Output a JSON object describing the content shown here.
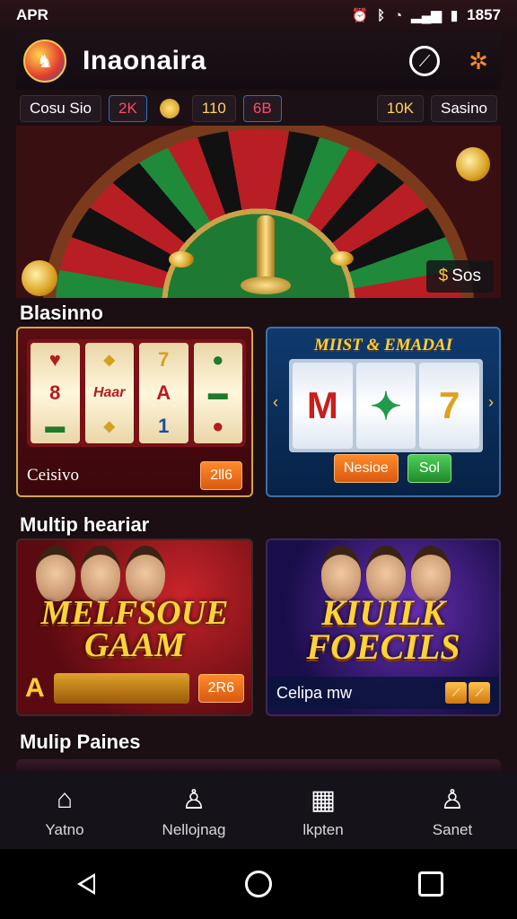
{
  "status_bar": {
    "left_label": "APR",
    "time": "1857",
    "icons": [
      "alarm-icon",
      "bluetooth-icon",
      "wifi-icon",
      "signal-icon",
      "battery-icon"
    ]
  },
  "app_bar": {
    "title": "Inaonaira",
    "icons": [
      "compass-icon",
      "tools-icon"
    ]
  },
  "chips": [
    {
      "label": "Cosu Sio"
    },
    {
      "label": "2K",
      "color": "#ff4b6a"
    },
    {
      "label": "110"
    },
    {
      "label": "6B",
      "color": "#ff4b6a"
    },
    {
      "label": "10K",
      "color": "#ffd25a"
    },
    {
      "label": "Sasino"
    }
  ],
  "hero": {
    "badge_currency": "$",
    "badge_label": "Sos"
  },
  "sections": [
    {
      "title": "Blasinno"
    },
    {
      "title": "Multip heariar"
    },
    {
      "title": "Mulip Paines"
    }
  ],
  "casino_cards": {
    "slot_left": {
      "reels": [
        [
          "♥",
          "8",
          "▬"
        ],
        [
          "◆",
          "Haar",
          "◆"
        ],
        [
          "7",
          "A",
          "1"
        ],
        [
          "●",
          "▬",
          "●"
        ]
      ],
      "label": "Ceisivo",
      "button": "2ll6"
    },
    "slot_right": {
      "banner": "MIIST & EMADAI",
      "reels": [
        "M",
        "✦",
        "7"
      ],
      "button_left": "Nesioe",
      "button_right": "Sol"
    }
  },
  "multiplayer_cards": {
    "left": {
      "title_line1": "MELFSOUE",
      "title_line2": "GAAM",
      "a_label": "A",
      "button": "2R6"
    },
    "right": {
      "title_line1": "KIUILK",
      "title_line2": "FOECILS",
      "label": "Celipa mw"
    }
  },
  "bottom_nav": [
    {
      "label": "Yatno",
      "icon": "home-icon"
    },
    {
      "label": "Nellojnag",
      "icon": "person-icon"
    },
    {
      "label": "lkpten",
      "icon": "grid-icon"
    },
    {
      "label": "Sanet",
      "icon": "person-icon"
    }
  ],
  "colors": {
    "accent_gold": "#ffd23a",
    "accent_orange": "#ff8a2a",
    "background": "#1b0f14"
  }
}
